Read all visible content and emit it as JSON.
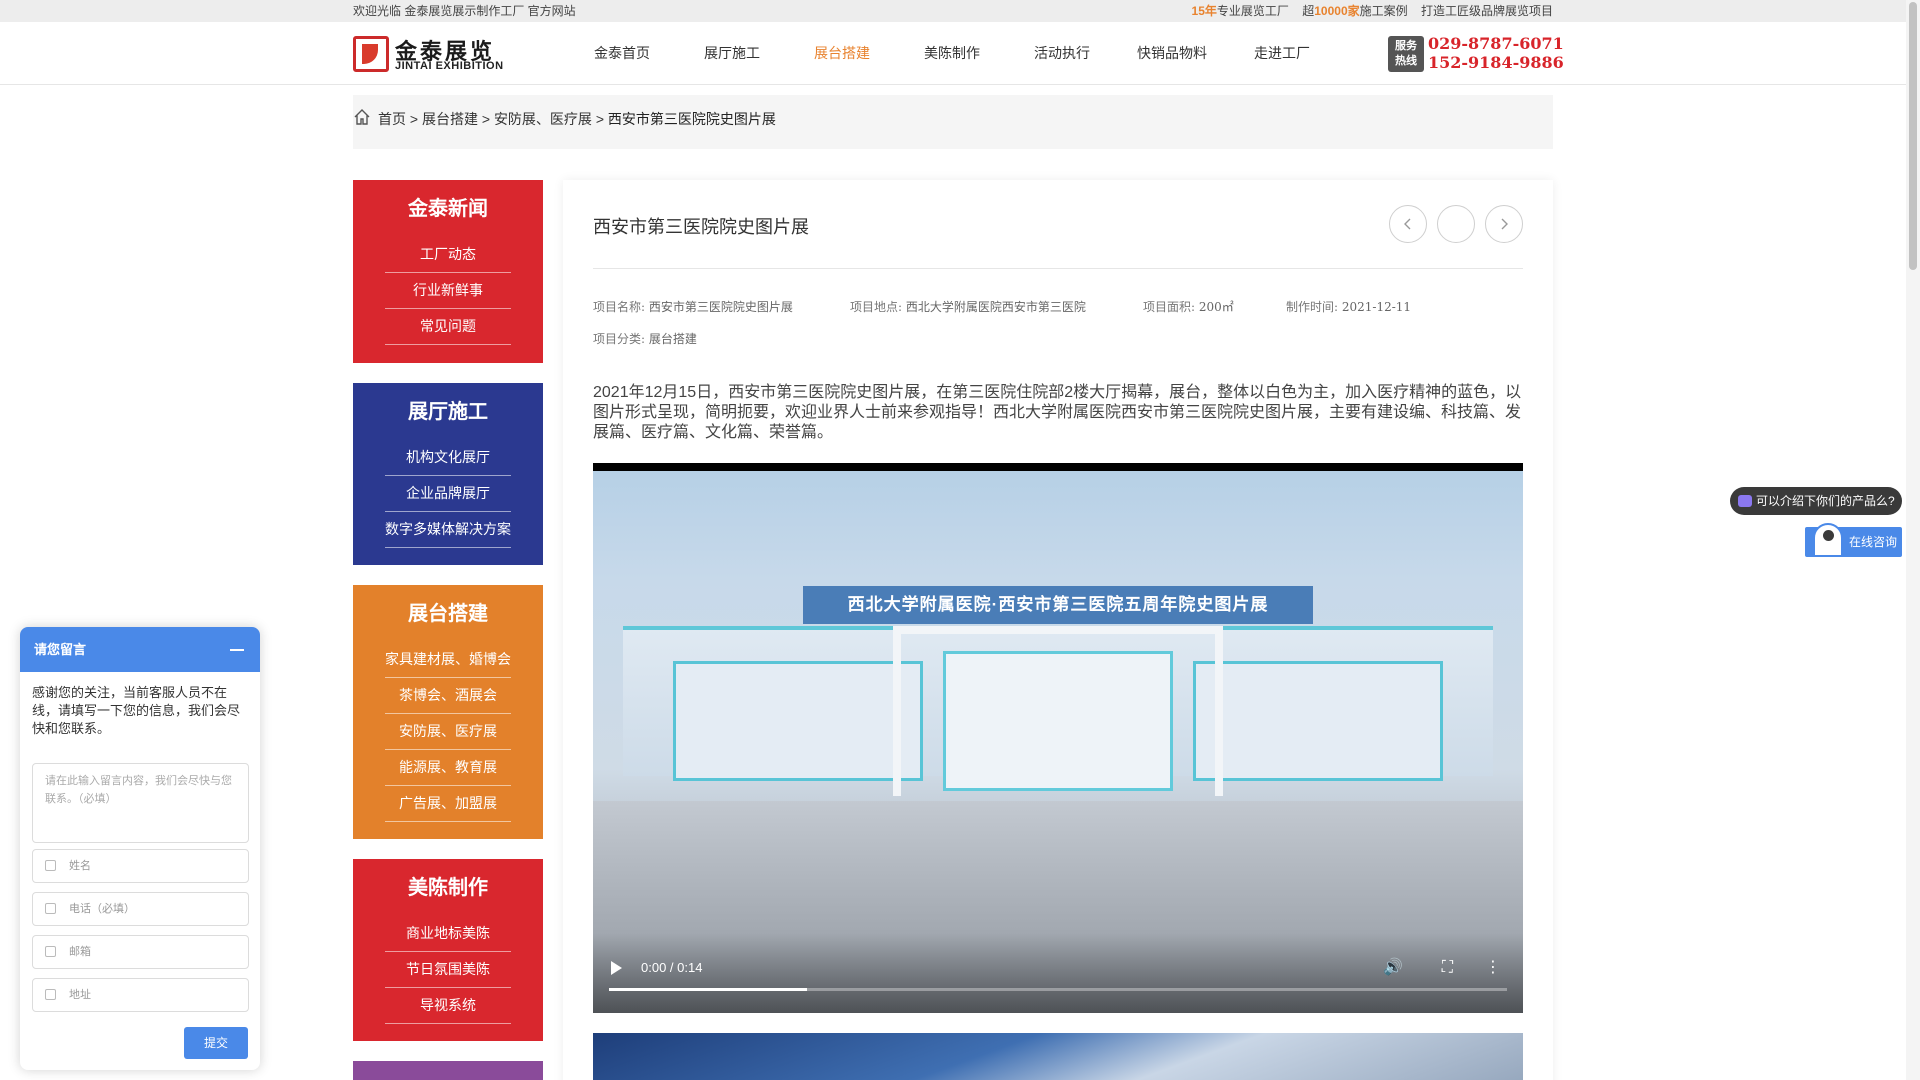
{
  "topbar": {
    "welcome": "欢迎光临 金泰展览展示制作工厂 官方网站",
    "stat1_num": "15年",
    "stat1_text": "专业展览工厂",
    "stat2_prefix": "超",
    "stat2_num": "10000家",
    "stat2_text": "施工案例",
    "stat3": "打造工匠级品牌展览项目"
  },
  "logo": {
    "cn": "金泰展览",
    "en": "JINTAI EXHIBITION"
  },
  "nav": [
    {
      "label": "金泰首页",
      "active": false
    },
    {
      "label": "展厅施工",
      "active": false
    },
    {
      "label": "展台搭建",
      "active": true
    },
    {
      "label": "美陈制作",
      "active": false
    },
    {
      "label": "活动执行",
      "active": false
    },
    {
      "label": "快销品物料",
      "active": false
    },
    {
      "label": "走进工厂",
      "active": false
    }
  ],
  "hotline": {
    "badge_top": "服务",
    "badge_bottom": "热线",
    "phone1": "029-8787-6071",
    "phone2": "152-9184-9886"
  },
  "breadcrumb": {
    "home": "首页",
    "level1": "展台搭建",
    "level2": "安防展、医疗展",
    "current": "西安市第三医院院史图片展",
    "separator": ">"
  },
  "sidebar": [
    {
      "title": "金泰新闻",
      "color": "#d9272e",
      "items": [
        "工厂动态",
        "行业新鲜事",
        "常见问题"
      ]
    },
    {
      "title": "展厅施工",
      "color": "#2b3990",
      "items": [
        "机构文化展厅",
        "企业品牌展厅",
        "数字多媒体解决方案"
      ]
    },
    {
      "title": "展台搭建",
      "color": "#e3812b",
      "items": [
        "家具建材展、婚博会",
        "茶博会、酒展会",
        "安防展、医疗展",
        "能源展、教育展",
        "广告展、加盟展"
      ]
    },
    {
      "title": "美陈制作",
      "color": "#d9272e",
      "items": [
        "商业地标美陈",
        "节日氛围美陈",
        "导视系统"
      ]
    }
  ],
  "article": {
    "title": "西安市第三医院院史图片展",
    "meta": {
      "name_key": "项目名称:",
      "name_val": "西安市第三医院院史图片展",
      "place_key": "项目地点:",
      "place_val": "西北大学附属医院西安市第三医院",
      "area_key": "项目面积:",
      "area_val": "200㎡",
      "date_key": "制作时间:",
      "date_val": "2021-12-11",
      "category_key": "项目分类:",
      "category_val": "展台搭建"
    },
    "description": "2021年12月15日，西安市第三医院院史图片展，在第三医院住院部2楼大厅揭幕，展台，整体以白色为主，加入医疗精神的蓝色，以图片形式呈现，简明扼要，欢迎业界人士前来参观指导！西北大学附属医院西安市第三医院院史图片展，主要有建设编、科技篇、发展篇、医疗篇、文化篇、荣誉篇。"
  },
  "video": {
    "banner_text": "西北大学附属医院·西安市第三医院五周年院史图片展",
    "time": "0:00 / 0:14",
    "buffered_fraction": 0.22
  },
  "floating": {
    "ask_text": "可以介绍下你们的产品么?",
    "consult_text": "在线咨询"
  },
  "chat": {
    "header": "请您留言",
    "notice": "感谢您的关注，当前客服人员不在线，请填写一下您的信息，我们会尽快和您联系。",
    "message_placeholder": "请在此输入留言内容，我们会尽快与您联系。（必填）",
    "name_placeholder": "姓名",
    "phone_placeholder": "电话（必填）",
    "email_placeholder": "邮箱",
    "address_placeholder": "地址",
    "submit": "提交"
  },
  "colors": {
    "accent": "#e8832f",
    "brand_red": "#d8242a",
    "chat_blue": "#4a89e8"
  }
}
